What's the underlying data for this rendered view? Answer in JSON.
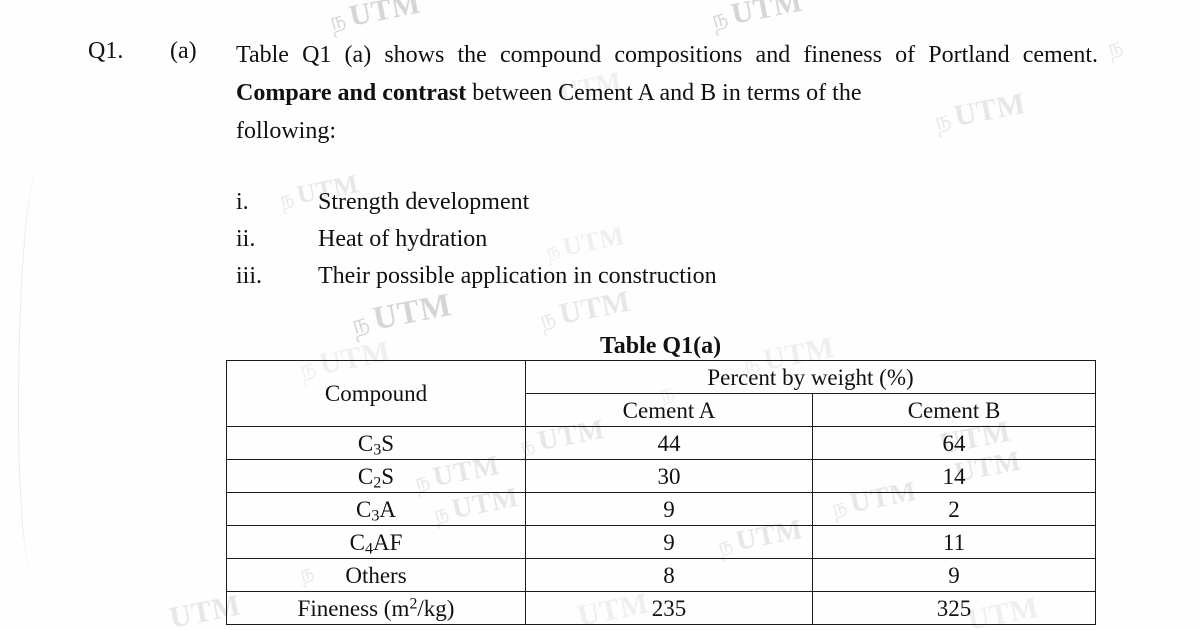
{
  "document": {
    "question_number": "Q1.",
    "question_part": "(a)",
    "body_line1": "Table Q1 (a) shows the compound compositions and fineness of Portland",
    "body_line2_pre": "cement. ",
    "body_line2_bold": "Compare and contrast",
    "body_line2_post": " between Cement A and B in terms of the",
    "body_line3": "following:"
  },
  "list": {
    "items": [
      {
        "marker": "i.",
        "text": "Strength development"
      },
      {
        "marker": "ii.",
        "text": "Heat of hydration"
      },
      {
        "marker": "iii.",
        "text": "Their possible application in construction"
      }
    ]
  },
  "table": {
    "caption": "Table Q1(a)",
    "header": {
      "compound": "Compound",
      "group": "Percent by weight (%)",
      "col_a": "Cement A",
      "col_b": "Cement B"
    },
    "rows": [
      {
        "compound_pre": "C",
        "compound_sub": "3",
        "compound_post": "S",
        "cement_a": "44",
        "cement_b": "64"
      },
      {
        "compound_pre": "C",
        "compound_sub": "2",
        "compound_post": "S",
        "cement_a": "30",
        "cement_b": "14"
      },
      {
        "compound_pre": "C",
        "compound_sub": "3",
        "compound_post": "A",
        "cement_a": "9",
        "cement_b": "2"
      },
      {
        "compound_pre": "C",
        "compound_sub": "4",
        "compound_post": "AF",
        "cement_a": "9",
        "cement_b": "11"
      },
      {
        "compound_pre": "Others",
        "compound_sub": "",
        "compound_post": "",
        "cement_a": "8",
        "cement_b": "9"
      },
      {
        "compound_pre": "Fineness (m",
        "compound_sup": "2",
        "compound_post": "/kg)",
        "cement_a": "235",
        "cement_b": "325"
      }
    ]
  },
  "watermark": {
    "text": "UTM",
    "logo_glyph": "ந",
    "color": "#7a7c82"
  }
}
